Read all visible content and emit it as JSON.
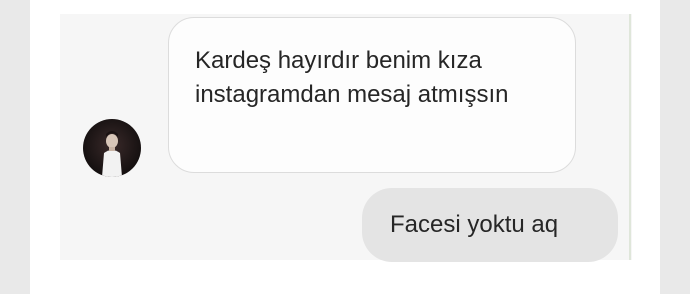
{
  "messages": [
    {
      "side": "incoming",
      "text": "Kardeş hayırdır benim kıza instagramdan mesaj atmışsın"
    },
    {
      "side": "outgoing",
      "text": "Facesi yoktu aq"
    }
  ],
  "avatar": {
    "icon": "profile-photo"
  },
  "colors": {
    "incoming_bubble": "#fdfdfd",
    "outgoing_bubble": "#e4e4e4",
    "text": "#262626"
  }
}
